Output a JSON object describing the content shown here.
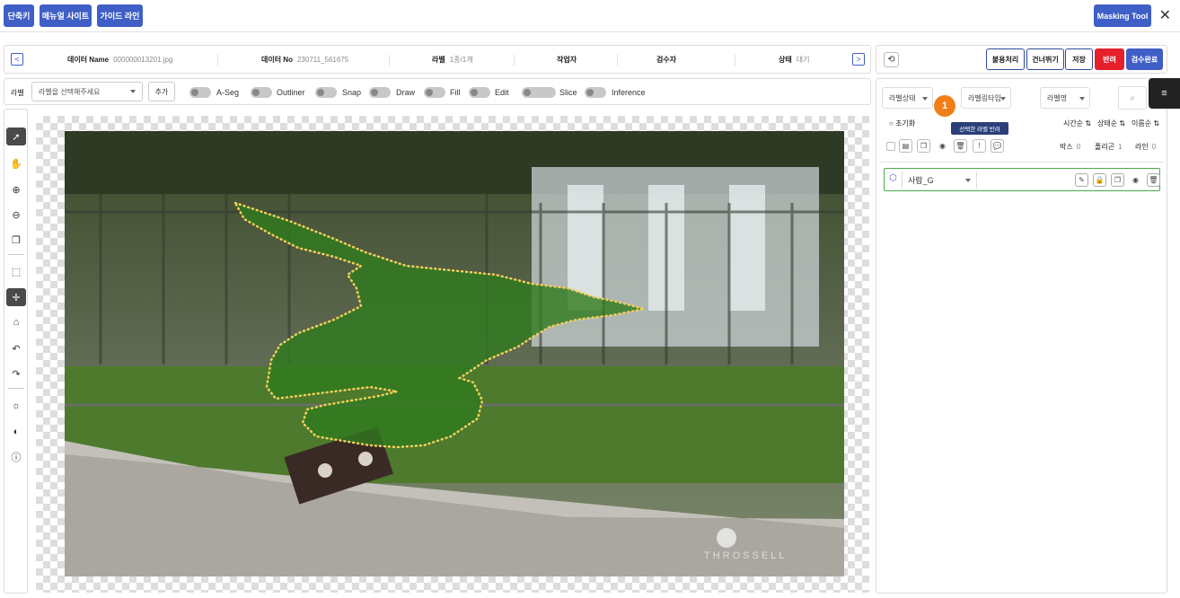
{
  "topbar": {
    "shortcut": "단축키",
    "manual": "메뉴얼 사이트",
    "guide": "가이드 라인",
    "masking_tool": "Masking Tool",
    "close": "✕"
  },
  "info": {
    "prev": "<",
    "next": ">",
    "data_name_label": "데이터 Name",
    "data_name_value": "000000013201.jpg",
    "data_no_label": "데이터 No",
    "data_no_value": "230711_561675",
    "label_label": "라벨",
    "label_value": "1종/1개",
    "worker_label": "작업자",
    "reviewer_label": "검수자",
    "status_label": "상태",
    "status_value": "대기"
  },
  "toolbar": {
    "label": "라벨",
    "label_select_placeholder": "라벨을 선택해주세요",
    "add": "추가",
    "toggles": [
      "A-Seg",
      "Outliner",
      "Snap",
      "Draw",
      "Fill",
      "Edit",
      "Slice",
      "Inference"
    ]
  },
  "right_header": {
    "reject_process": "불용처리",
    "skip": "건너뛰기",
    "save": "저장",
    "return": "반려",
    "review_done": "검수완료"
  },
  "right_panel": {
    "filter_status": "라벨상태",
    "filter_type": "라벨링타입",
    "filter_name": "라벨명",
    "reset": "초기화",
    "sort_time": "시간순",
    "sort_status": "상태순",
    "sort_name": "이름순",
    "box_label": "박스",
    "box_count": "0",
    "polygon_label": "폴리곤",
    "polygon_count": "1",
    "line_label": "라인",
    "line_count": "0",
    "tooltip": "선택한 라벨 반려",
    "badge": "1",
    "label_item_name": "사람_G"
  },
  "watermark": "THROSSELL",
  "colors": {
    "brand_blue": "#3f5fc6",
    "reject_red": "#e5202a",
    "mask_green": "#2f7a1e",
    "badge_orange": "#f07f19"
  }
}
